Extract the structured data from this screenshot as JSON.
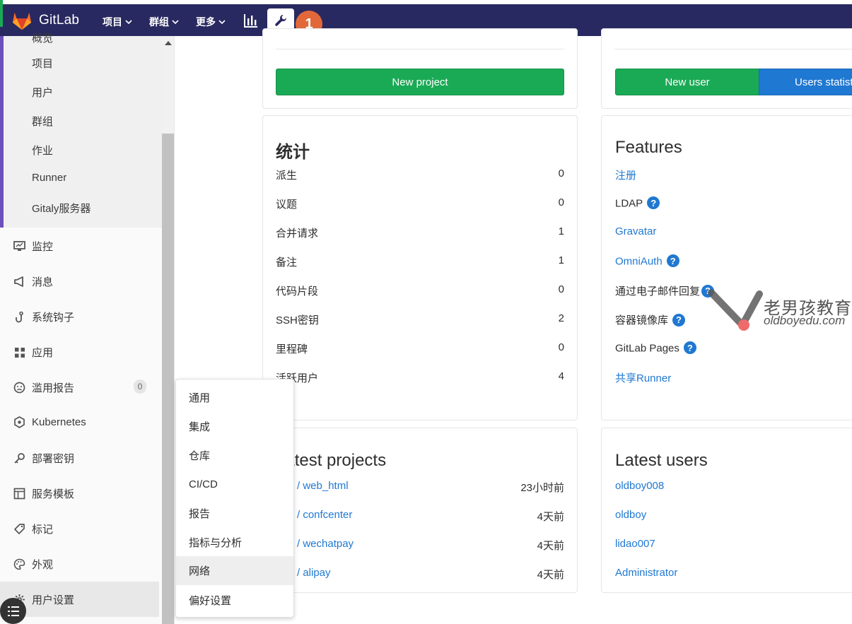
{
  "nav": {
    "brand": "GitLab",
    "items": [
      {
        "label": "项目"
      },
      {
        "label": "群组"
      },
      {
        "label": "更多"
      }
    ],
    "step_badge": "1"
  },
  "sidebar": {
    "sub_top_cut": "概览",
    "sub_items": [
      "项目",
      "用户",
      "群组",
      "作业",
      "Runner",
      "Gitaly服务器"
    ],
    "items": [
      {
        "label": "监控",
        "icon": "monitor-icon"
      },
      {
        "label": "消息",
        "icon": "megaphone-icon"
      },
      {
        "label": "系统钩子",
        "icon": "hook-icon"
      },
      {
        "label": "应用",
        "icon": "apps-grid-icon"
      },
      {
        "label": "滥用报告",
        "icon": "frown-face-icon"
      },
      {
        "label": "Kubernetes",
        "icon": "kubernetes-icon"
      },
      {
        "label": "部署密钥",
        "icon": "key-icon"
      },
      {
        "label": "服务模板",
        "icon": "template-icon"
      },
      {
        "label": "标记",
        "icon": "tag-icon"
      },
      {
        "label": "外观",
        "icon": "palette-icon"
      },
      {
        "label": "用户设置",
        "icon": "gear-icon"
      }
    ],
    "abuse_count": "0"
  },
  "projects_card": {
    "button": "New project"
  },
  "users_card": {
    "button_new": "New user",
    "button_stats": "Users statistics"
  },
  "stats": {
    "title": "统计",
    "rows": [
      {
        "label": "派生",
        "value": "0"
      },
      {
        "label": "议题",
        "value": "0"
      },
      {
        "label": "合并请求",
        "value": "1"
      },
      {
        "label": "备注",
        "value": "1"
      },
      {
        "label": "代码片段",
        "value": "0"
      },
      {
        "label": "SSH密钥",
        "value": "2"
      },
      {
        "label": "里程碑",
        "value": "0"
      },
      {
        "label": "活跃用户",
        "value": "4"
      }
    ]
  },
  "features": {
    "title": "Features",
    "rows": [
      {
        "label": "注册",
        "link": true,
        "help": false
      },
      {
        "label": "LDAP",
        "link": false,
        "help": true
      },
      {
        "label": "Gravatar",
        "link": true,
        "help": false
      },
      {
        "label": "OmniAuth",
        "link": true,
        "help": true
      },
      {
        "label": "通过电子邮件回复",
        "link": false,
        "help": true
      },
      {
        "label": "容器镜像库",
        "link": false,
        "help": true
      },
      {
        "label": "GitLab Pages",
        "link": false,
        "help": true
      },
      {
        "label": "共享Runner",
        "link": true,
        "help": false
      }
    ],
    "help_glyph": "?"
  },
  "latest_projects": {
    "title": "Latest projects",
    "rows": [
      {
        "name": "/ web_html",
        "time": "23小时前"
      },
      {
        "name": "/ confcenter",
        "time": "4天前"
      },
      {
        "name": "/ wechatpay",
        "time": "4天前"
      },
      {
        "name": "/ alipay",
        "time": "4天前"
      }
    ]
  },
  "latest_users": {
    "title": "Latest users",
    "rows": [
      "oldboy008",
      "oldboy",
      "lidao007",
      "Administrator"
    ]
  },
  "settings_menu": {
    "items": [
      "通用",
      "集成",
      "仓库",
      "CI/CD",
      "报告",
      "指标与分析",
      "网络",
      "偏好设置"
    ],
    "hovered": "网络"
  },
  "watermark": {
    "cn": "老男孩教育",
    "en": "oldboyedu.com"
  }
}
